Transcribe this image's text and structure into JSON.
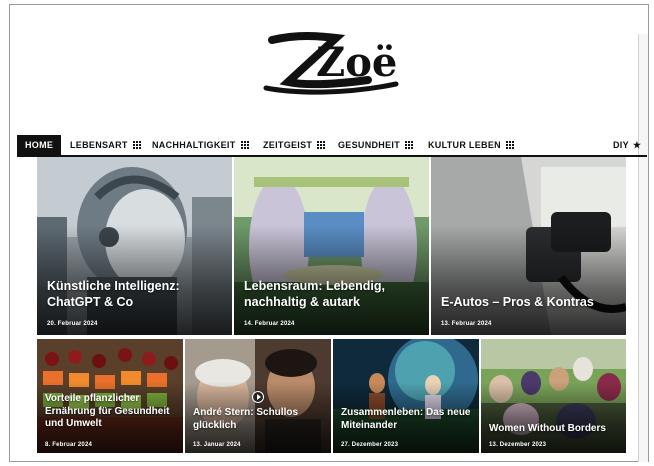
{
  "site": {
    "logo_text": "Zoë"
  },
  "nav": {
    "items": [
      {
        "label": "HOME",
        "icon": ""
      },
      {
        "label": "LEBENSART",
        "icon": "grid-icon"
      },
      {
        "label": "NACHHALTIGKEIT",
        "icon": "grid-icon"
      },
      {
        "label": "ZEITGEIST",
        "icon": "grid-icon"
      },
      {
        "label": "GESUNDHEIT",
        "icon": "grid-icon"
      },
      {
        "label": "KULTUR LEBEN",
        "icon": "grid-icon"
      },
      {
        "label": "DIY",
        "icon": "star-icon"
      }
    ],
    "star_glyph": "★"
  },
  "articles_top": [
    {
      "title": "Künstliche Intelligenz: ChatGPT & Co",
      "date": "20. Februar 2024"
    },
    {
      "title": "Lebensraum: Lebendig, nachhaltig & autark",
      "date": "14. Februar 2024"
    },
    {
      "title": "E-Autos – Pros & Kontras",
      "date": "13. Februar 2024"
    }
  ],
  "articles_bottom": [
    {
      "title": "Vorteile pflanzlicher Ernährung für Gesundheit und Umwelt",
      "date": "8. Februar 2024"
    },
    {
      "title": "André Stern: Schullos glücklich",
      "date": "13. Januar 2024",
      "has_video": true
    },
    {
      "title": "Zusammenleben: Das neue Miteinander",
      "date": "27. Dezember 2023"
    },
    {
      "title": "Women Without Borders",
      "date": "13. Dezember 2023"
    }
  ],
  "colors": {
    "nav_active_bg": "#111111",
    "text_on_image": "#ffffff",
    "page_bg": "#ffffff"
  }
}
